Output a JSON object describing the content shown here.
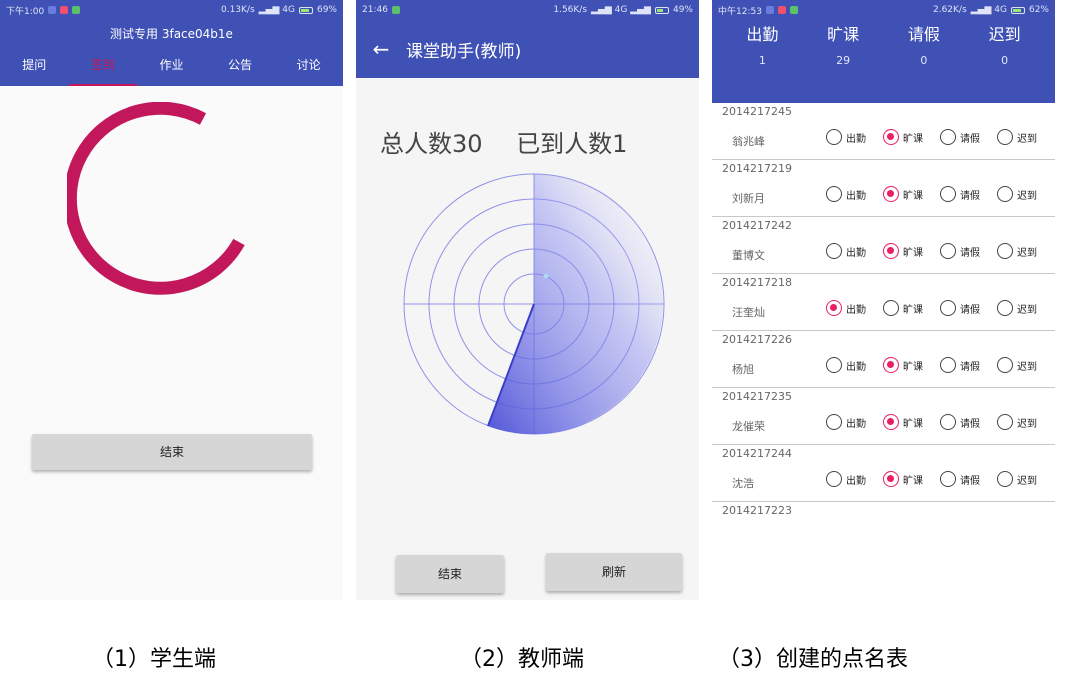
{
  "colors": {
    "primary": "#3f51b5",
    "accent": "#c2185b",
    "radio_on": "#e91e63"
  },
  "screen1": {
    "status_time": "下午1:00",
    "status_speed": "0.13K/s",
    "status_battery": "69%",
    "title": "测试专用 3face04b1e",
    "tabs": [
      "提问",
      "签到",
      "作业",
      "公告",
      "讨论"
    ],
    "active_tab": 1,
    "end_button": "结束"
  },
  "screen2": {
    "status_time": "21:46",
    "status_speed": "1.56K/s",
    "status_battery": "49%",
    "title": "课堂助手(教师)",
    "total_label": "总人数30",
    "arrived_label": "已到人数1",
    "end_button": "结束",
    "refresh_button": "刷新"
  },
  "screen3": {
    "status_time": "中午12:53",
    "status_speed": "2.62K/s",
    "status_battery": "62%",
    "headers": [
      "出勤",
      "旷课",
      "请假",
      "迟到"
    ],
    "header_values": [
      "1",
      "29",
      "0",
      "0"
    ],
    "options": [
      "出勤",
      "旷课",
      "请假",
      "迟到"
    ],
    "students": [
      {
        "id": "2014217245",
        "name": "翁兆峰",
        "status": 1
      },
      {
        "id": "2014217219",
        "name": "刘新月",
        "status": 1
      },
      {
        "id": "2014217242",
        "name": "董博文",
        "status": 1
      },
      {
        "id": "2014217218",
        "name": "汪奎灿",
        "status": 0
      },
      {
        "id": "2014217226",
        "name": "杨旭",
        "status": 1
      },
      {
        "id": "2014217235",
        "name": "龙催荣",
        "status": 1
      },
      {
        "id": "2014217244",
        "name": "沈浩",
        "status": 1
      }
    ],
    "partial_id": "2014217223"
  },
  "captions": [
    "（1）学生端",
    "（2）教师端",
    "（3）创建的点名表"
  ]
}
